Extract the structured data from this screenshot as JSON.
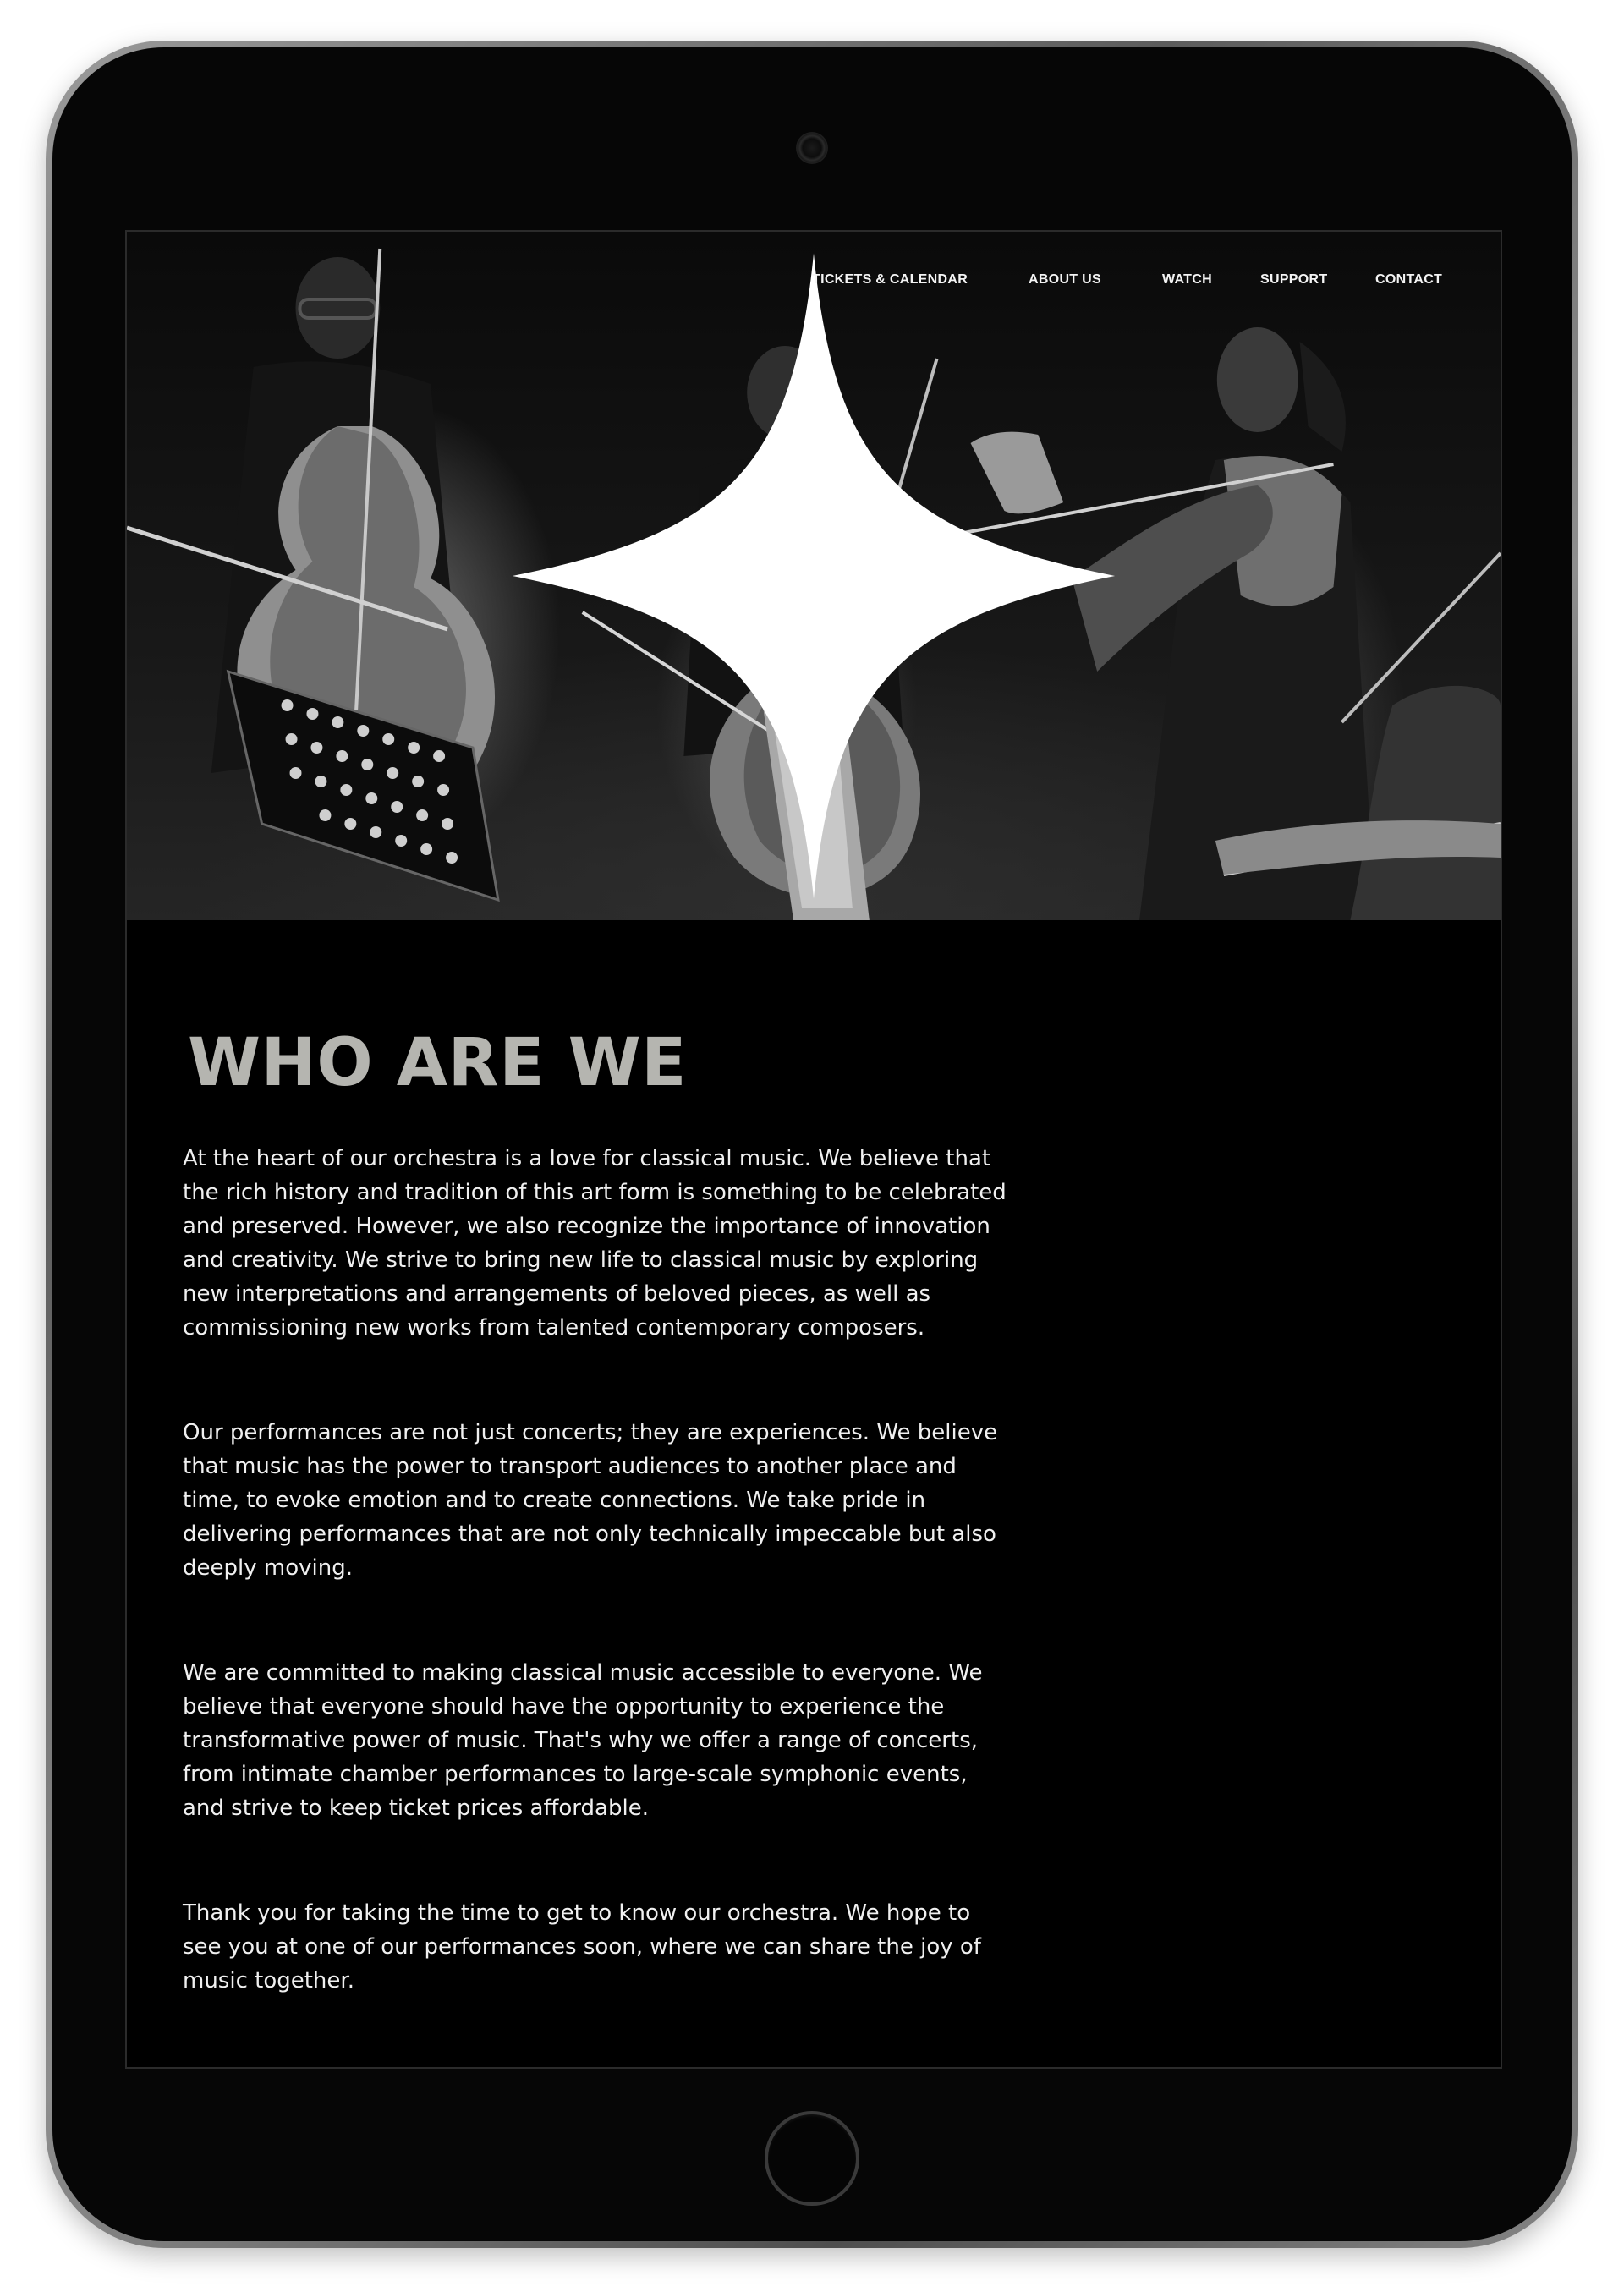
{
  "nav": {
    "items": [
      {
        "label": "TICKETS & CALENDAR"
      },
      {
        "label": "ABOUT US"
      },
      {
        "label": "WATCH"
      },
      {
        "label": "SUPPORT"
      },
      {
        "label": "CONTACT"
      }
    ],
    "logo_icon": "four-point-star-icon"
  },
  "hero": {
    "image": "black-and-white photo of string musicians playing cellos and violin"
  },
  "about": {
    "title": "WHO ARE WE",
    "paragraphs": [
      "At the heart of our orchestra is a love for classical music. We believe that the rich history and tradition of this art form is something to be celebrated and preserved. However, we also recognize the importance of innovation and creativity. We strive to bring new life to classical music by exploring new interpretations and arrangements of beloved pieces, as well as commissioning new works from talented contemporary composers.",
      "Our performances are not just concerts; they are experiences. We believe that music has the power to transport audiences to another place and time, to evoke emotion and to create connections. We take pride in delivering performances that are not only technically impeccable but also deeply moving.",
      "We are committed to making classical music accessible to everyone. We believe that everyone should have the opportunity to experience the transformative power of music. That's why we offer a range of concerts, from intimate chamber performances to large-scale symphonic events, and strive to keep ticket prices affordable.",
      "Thank you for taking the time to get to know our orchestra. We hope to see you at one of our performances soon, where we can share the joy of music together."
    ]
  },
  "colors": {
    "background": "#000000",
    "title": "#b5b5b0",
    "text": "#f0f0f0",
    "device_bezel": "#060606"
  }
}
